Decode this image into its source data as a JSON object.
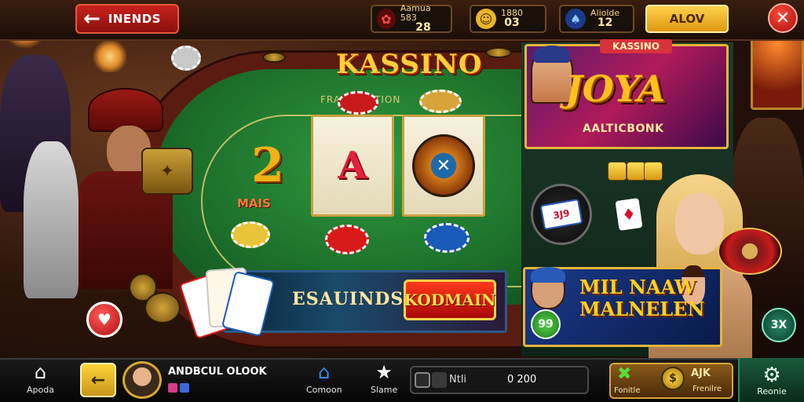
{
  "topbar": {
    "back_label": "INENDS",
    "back_icon": "arrow-left-icon",
    "stats": [
      {
        "icon": "ruby-icon",
        "line1": "Aamua 583",
        "line2": "28",
        "color": "#d82a2a"
      },
      {
        "icon": "coin-icon",
        "line1": "1880",
        "line2": "03",
        "color": "#e8b42a"
      },
      {
        "icon": "card-icon",
        "line1": "Aliolde",
        "line2": "12",
        "color": "#2a6ad8"
      }
    ],
    "allow_label": "ALOV",
    "close_symbol": "✕"
  },
  "table": {
    "brand": "KASSINO",
    "felt_text": "FRAME DATION",
    "reel_number": "2",
    "reel_letter": "A",
    "reel_coin_text": "✕",
    "mais_label": "MAIS"
  },
  "banner": {
    "text": "ESAUINDS",
    "button_label": "KODMAIN"
  },
  "heart_symbol": "♥",
  "side": {
    "promo_tag": "KASSINO",
    "promo_title": "JOYA",
    "promo_subtitle": "AALTICBONK",
    "card_text": "3J9",
    "diamond_symbol": "♦",
    "bottom_title_line1": "MIL NAAW",
    "bottom_title_line2": "MALNELEN",
    "badge_text": "99",
    "right_badge_text": "3X"
  },
  "bottombar": {
    "home_label": "Apoda",
    "home_icon": "house-icon",
    "back_symbol": "←",
    "profile_name": "ANDBCUL OLOOK",
    "community_label": "Comoon",
    "community_icon": "house-star-icon",
    "stars_label": "Slame",
    "stars_icon": "star-badge-icon",
    "progress_label": "Ntli",
    "progress_value": "0 200",
    "progress_fraction": 0.1,
    "reward_left_label": "Fonitle",
    "reward_coin_symbol": "$",
    "reward_title": "AJK",
    "reward_sub": "Frenilre",
    "settings_label": "Reonie",
    "settings_icon": "gear-icon"
  }
}
